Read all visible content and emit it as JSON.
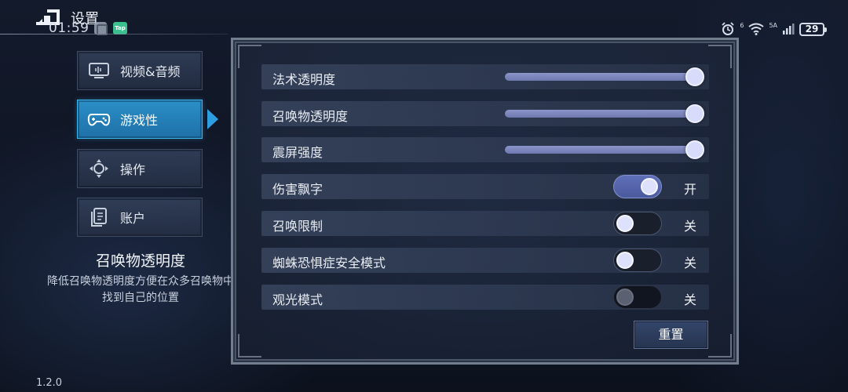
{
  "header": {
    "title": "设置",
    "time": "01:59",
    "tap_badge": "Tap"
  },
  "status": {
    "network": "6",
    "signal_type": "5A",
    "battery": "29"
  },
  "sidebar": {
    "items": [
      {
        "label": "视频&音频",
        "icon": "monitor-icon",
        "active": false
      },
      {
        "label": "游戏性",
        "icon": "gamepad-icon",
        "active": true
      },
      {
        "label": "操作",
        "icon": "dpad-icon",
        "active": false
      },
      {
        "label": "账户",
        "icon": "document-icon",
        "active": false
      }
    ]
  },
  "description": {
    "title": "召唤物透明度",
    "text": "降低召唤物透明度方便在众多召唤物中找到自己的位置"
  },
  "settings": {
    "sliders": [
      {
        "label": "法术透明度",
        "value": 1.0
      },
      {
        "label": "召唤物透明度",
        "value": 1.0
      },
      {
        "label": "震屏强度",
        "value": 1.0
      }
    ],
    "toggles": [
      {
        "label": "伤害飘字",
        "state": "开",
        "on": true
      },
      {
        "label": "召唤限制",
        "state": "关",
        "on": false
      },
      {
        "label": "蜘蛛恐惧症安全模式",
        "state": "关",
        "on": false
      },
      {
        "label": "观光模式",
        "state": "关",
        "on": false,
        "disabled": true
      }
    ],
    "reset_label": "重置"
  },
  "version": "1.2.0",
  "colors": {
    "accent": "#2a8fc6",
    "slider_thumb": "#d7dcfb",
    "toggle_on": "#5f6fb8"
  }
}
